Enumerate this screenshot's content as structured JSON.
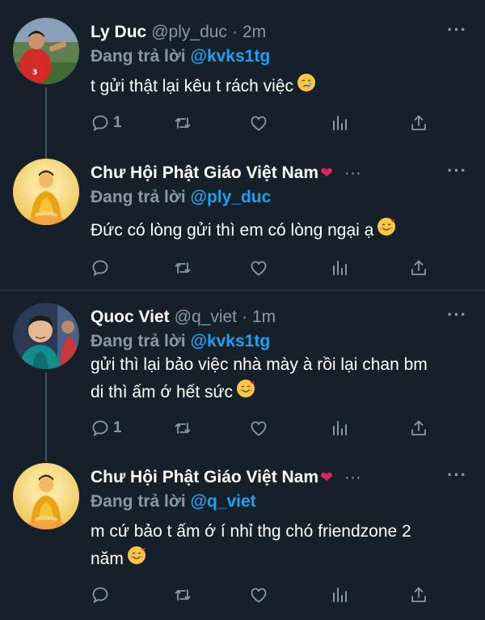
{
  "tweets": [
    {
      "name": "Ly Duc",
      "handle": "@ply_duc",
      "separator": "·",
      "time": "2m",
      "verified_heart": "",
      "more": "···",
      "reply_label": "Đang trả lời",
      "reply_to": "@kvks1tg",
      "lines": [
        "t gửi thật lại kêu t rách việc"
      ],
      "emoji": "crying-face",
      "reply_count": "1"
    },
    {
      "name": "Chư Hội Phật Giáo Việt Nam",
      "handle": "",
      "separator": "",
      "time": "",
      "verified_heart": "❤",
      "more": "···",
      "header_dots": "···",
      "reply_label": "Đang trả lời",
      "reply_to": "@ply_duc",
      "lines": [
        "Đức có lòng gửi thì em có lòng ngại ạ"
      ],
      "emoji": "smiling-face-with-hearts",
      "reply_count": ""
    },
    {
      "name": "Quoc Viet",
      "handle": "@q_viet",
      "separator": "·",
      "time": "1m",
      "verified_heart": "",
      "more": "···",
      "reply_label": "Đang trả lời",
      "reply_to": "@kvks1tg",
      "lines": [
        "gửi thì lại bảo việc nhà mày à rồi lại chan bm",
        "di thì ấm ớ hết sức"
      ],
      "emoji": "smiling-face-with-hearts",
      "reply_count": "1"
    },
    {
      "name": "Chư Hội Phật Giáo Việt Nam",
      "handle": "",
      "separator": "",
      "time": "",
      "verified_heart": "❤",
      "more": "···",
      "header_dots": "···",
      "reply_label": "Đang trả lời",
      "reply_to": "@q_viet",
      "lines": [
        "m cứ bảo t ấm ớ í nhỉ thg chó friendzone 2",
        "năm"
      ],
      "emoji": "smiling-face-with-hearts",
      "reply_count": ""
    }
  ],
  "colors": {
    "background": "#15202b",
    "text": "#ffffff",
    "muted": "#8899a6",
    "link": "#1da1f2",
    "heart": "#e0245e",
    "divider": "#38444d"
  },
  "icons": [
    "reply-icon",
    "retweet-icon",
    "like-icon",
    "analytics-icon",
    "share-icon"
  ]
}
